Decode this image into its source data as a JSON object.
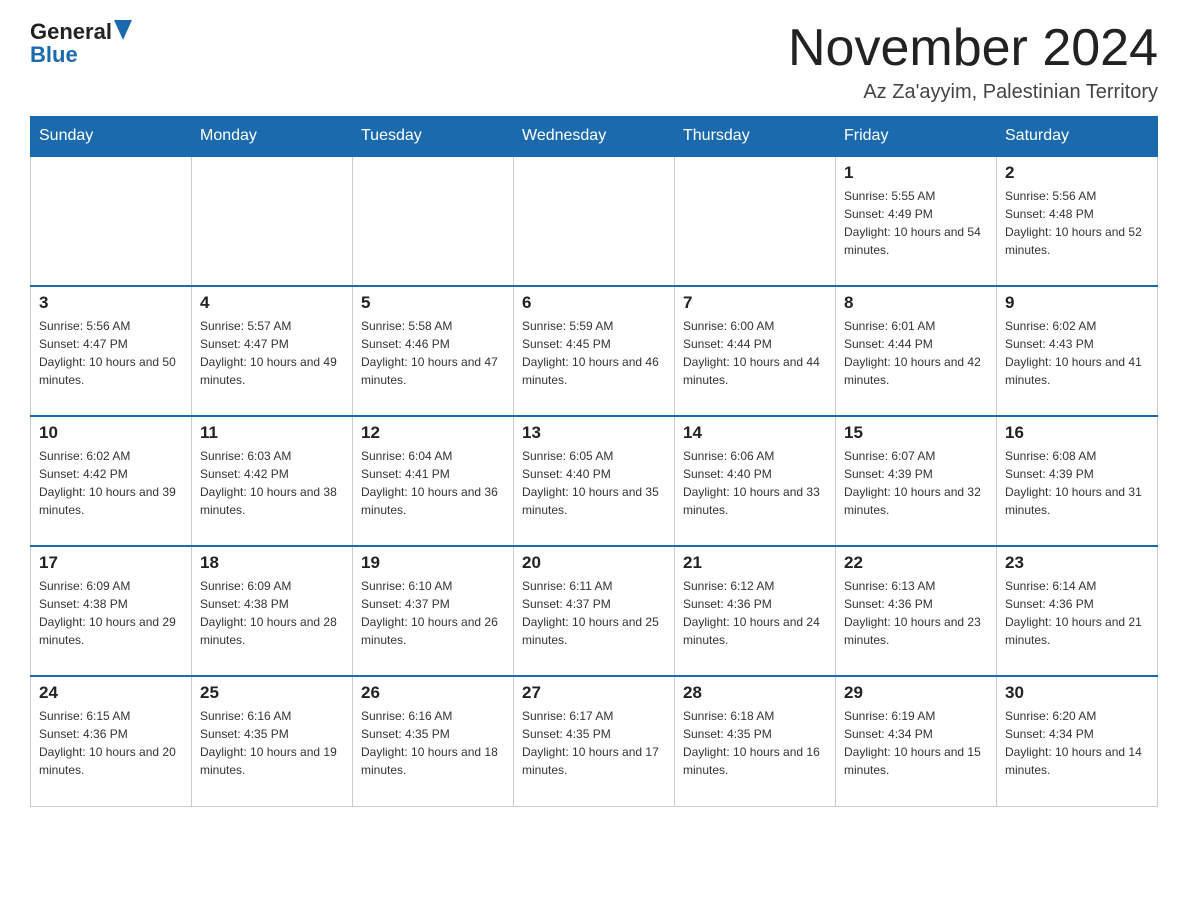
{
  "header": {
    "logo_general": "General",
    "logo_blue": "Blue",
    "title": "November 2024",
    "subtitle": "Az Za'ayyim, Palestinian Territory"
  },
  "days_of_week": [
    "Sunday",
    "Monday",
    "Tuesday",
    "Wednesday",
    "Thursday",
    "Friday",
    "Saturday"
  ],
  "weeks": [
    {
      "days": [
        {
          "number": "",
          "info": ""
        },
        {
          "number": "",
          "info": ""
        },
        {
          "number": "",
          "info": ""
        },
        {
          "number": "",
          "info": ""
        },
        {
          "number": "",
          "info": ""
        },
        {
          "number": "1",
          "info": "Sunrise: 5:55 AM\nSunset: 4:49 PM\nDaylight: 10 hours and 54 minutes."
        },
        {
          "number": "2",
          "info": "Sunrise: 5:56 AM\nSunset: 4:48 PM\nDaylight: 10 hours and 52 minutes."
        }
      ]
    },
    {
      "days": [
        {
          "number": "3",
          "info": "Sunrise: 5:56 AM\nSunset: 4:47 PM\nDaylight: 10 hours and 50 minutes."
        },
        {
          "number": "4",
          "info": "Sunrise: 5:57 AM\nSunset: 4:47 PM\nDaylight: 10 hours and 49 minutes."
        },
        {
          "number": "5",
          "info": "Sunrise: 5:58 AM\nSunset: 4:46 PM\nDaylight: 10 hours and 47 minutes."
        },
        {
          "number": "6",
          "info": "Sunrise: 5:59 AM\nSunset: 4:45 PM\nDaylight: 10 hours and 46 minutes."
        },
        {
          "number": "7",
          "info": "Sunrise: 6:00 AM\nSunset: 4:44 PM\nDaylight: 10 hours and 44 minutes."
        },
        {
          "number": "8",
          "info": "Sunrise: 6:01 AM\nSunset: 4:44 PM\nDaylight: 10 hours and 42 minutes."
        },
        {
          "number": "9",
          "info": "Sunrise: 6:02 AM\nSunset: 4:43 PM\nDaylight: 10 hours and 41 minutes."
        }
      ]
    },
    {
      "days": [
        {
          "number": "10",
          "info": "Sunrise: 6:02 AM\nSunset: 4:42 PM\nDaylight: 10 hours and 39 minutes."
        },
        {
          "number": "11",
          "info": "Sunrise: 6:03 AM\nSunset: 4:42 PM\nDaylight: 10 hours and 38 minutes."
        },
        {
          "number": "12",
          "info": "Sunrise: 6:04 AM\nSunset: 4:41 PM\nDaylight: 10 hours and 36 minutes."
        },
        {
          "number": "13",
          "info": "Sunrise: 6:05 AM\nSunset: 4:40 PM\nDaylight: 10 hours and 35 minutes."
        },
        {
          "number": "14",
          "info": "Sunrise: 6:06 AM\nSunset: 4:40 PM\nDaylight: 10 hours and 33 minutes."
        },
        {
          "number": "15",
          "info": "Sunrise: 6:07 AM\nSunset: 4:39 PM\nDaylight: 10 hours and 32 minutes."
        },
        {
          "number": "16",
          "info": "Sunrise: 6:08 AM\nSunset: 4:39 PM\nDaylight: 10 hours and 31 minutes."
        }
      ]
    },
    {
      "days": [
        {
          "number": "17",
          "info": "Sunrise: 6:09 AM\nSunset: 4:38 PM\nDaylight: 10 hours and 29 minutes."
        },
        {
          "number": "18",
          "info": "Sunrise: 6:09 AM\nSunset: 4:38 PM\nDaylight: 10 hours and 28 minutes."
        },
        {
          "number": "19",
          "info": "Sunrise: 6:10 AM\nSunset: 4:37 PM\nDaylight: 10 hours and 26 minutes."
        },
        {
          "number": "20",
          "info": "Sunrise: 6:11 AM\nSunset: 4:37 PM\nDaylight: 10 hours and 25 minutes."
        },
        {
          "number": "21",
          "info": "Sunrise: 6:12 AM\nSunset: 4:36 PM\nDaylight: 10 hours and 24 minutes."
        },
        {
          "number": "22",
          "info": "Sunrise: 6:13 AM\nSunset: 4:36 PM\nDaylight: 10 hours and 23 minutes."
        },
        {
          "number": "23",
          "info": "Sunrise: 6:14 AM\nSunset: 4:36 PM\nDaylight: 10 hours and 21 minutes."
        }
      ]
    },
    {
      "days": [
        {
          "number": "24",
          "info": "Sunrise: 6:15 AM\nSunset: 4:36 PM\nDaylight: 10 hours and 20 minutes."
        },
        {
          "number": "25",
          "info": "Sunrise: 6:16 AM\nSunset: 4:35 PM\nDaylight: 10 hours and 19 minutes."
        },
        {
          "number": "26",
          "info": "Sunrise: 6:16 AM\nSunset: 4:35 PM\nDaylight: 10 hours and 18 minutes."
        },
        {
          "number": "27",
          "info": "Sunrise: 6:17 AM\nSunset: 4:35 PM\nDaylight: 10 hours and 17 minutes."
        },
        {
          "number": "28",
          "info": "Sunrise: 6:18 AM\nSunset: 4:35 PM\nDaylight: 10 hours and 16 minutes."
        },
        {
          "number": "29",
          "info": "Sunrise: 6:19 AM\nSunset: 4:34 PM\nDaylight: 10 hours and 15 minutes."
        },
        {
          "number": "30",
          "info": "Sunrise: 6:20 AM\nSunset: 4:34 PM\nDaylight: 10 hours and 14 minutes."
        }
      ]
    }
  ]
}
